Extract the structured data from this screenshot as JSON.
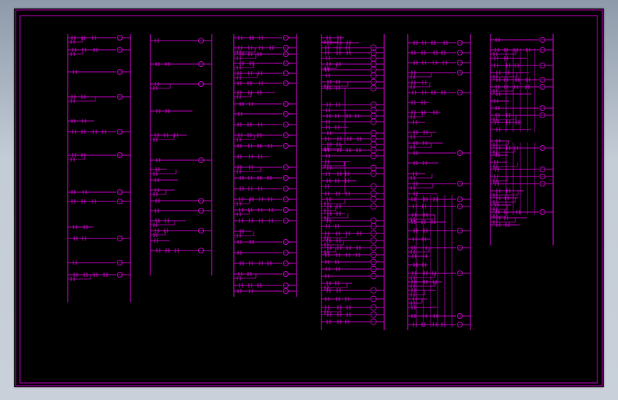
{
  "drawing": {
    "type": "PLC ladder diagram (CAD view)",
    "background_color": "#000000",
    "line_color": "#cc00cc",
    "page_bg_color": "#b8c2ce",
    "ladder_column_count": 6
  }
}
